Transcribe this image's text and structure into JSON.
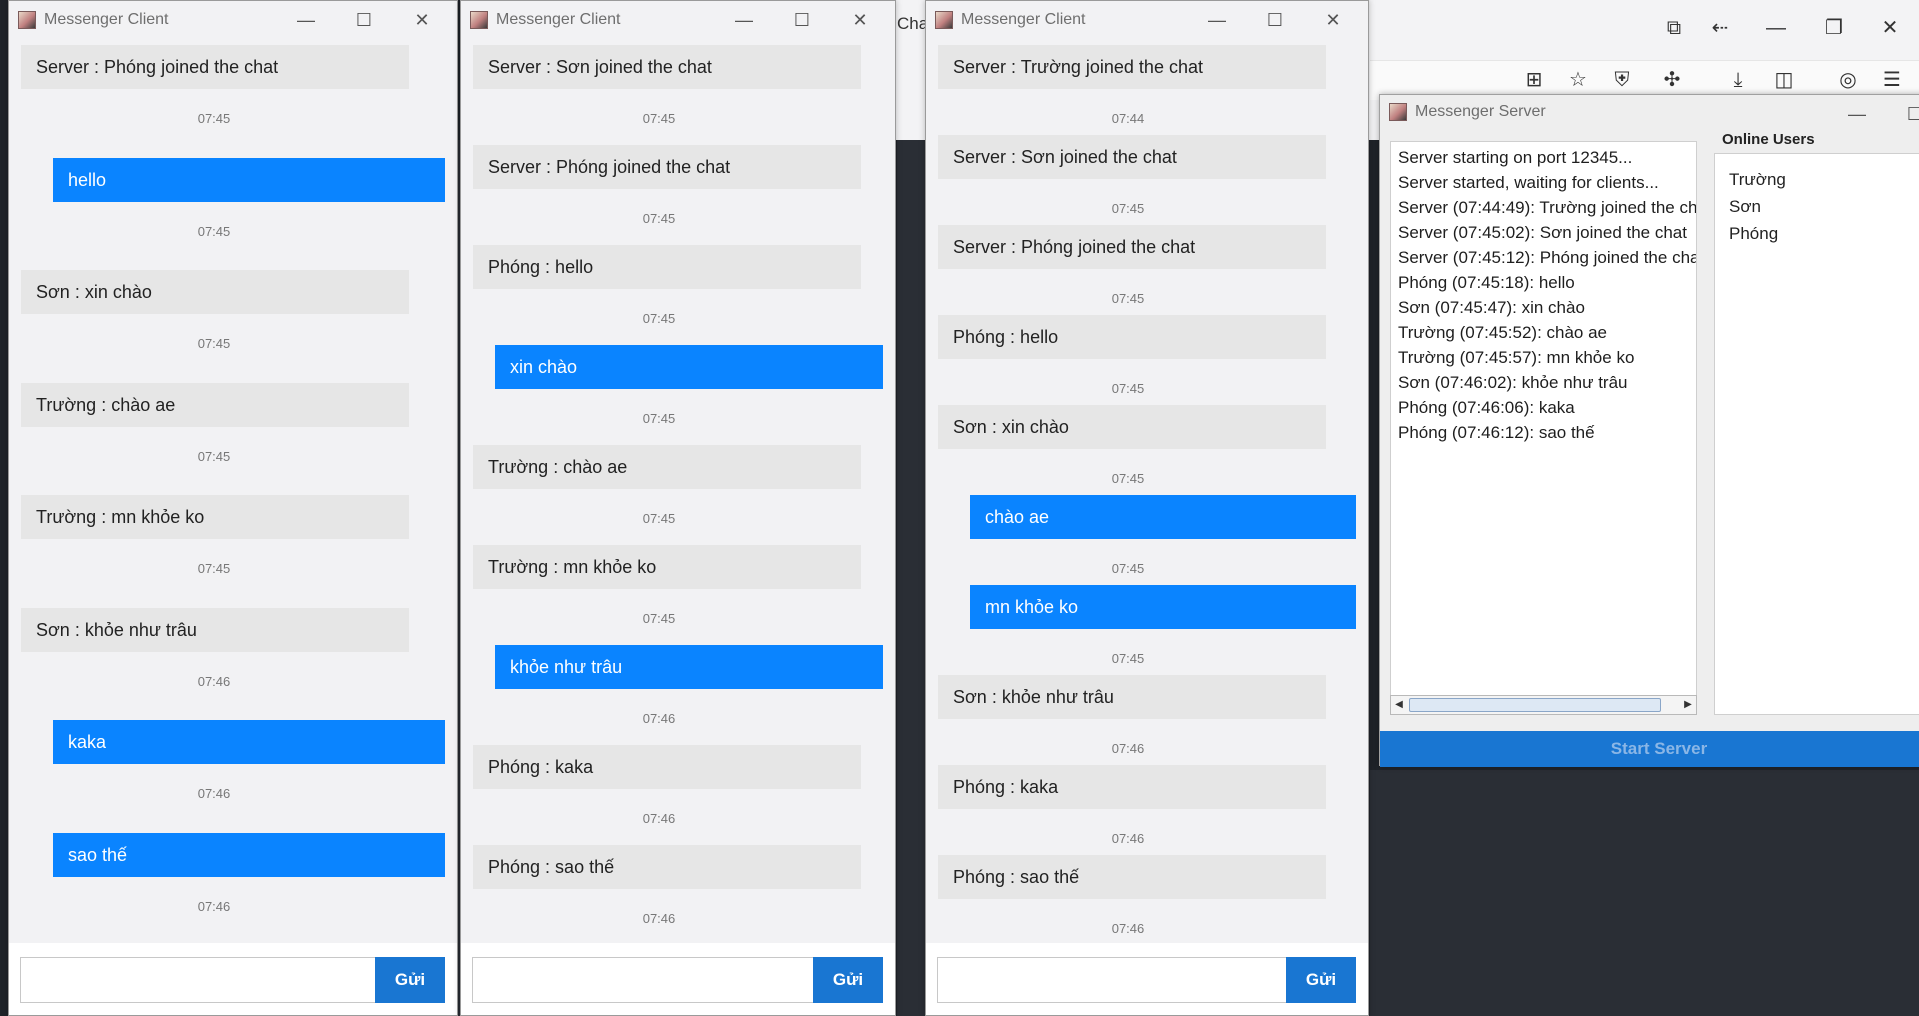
{
  "background": {
    "browser_label": "Chat"
  },
  "clients": [
    {
      "title": "Messenger Client",
      "send_label": "Gửi",
      "input_value": "",
      "messages": [
        {
          "type": "received",
          "text": "Server : Phóng joined the chat",
          "time": "07:45"
        },
        {
          "type": "sent",
          "text": "hello",
          "time": "07:45"
        },
        {
          "type": "received",
          "text": "Sơn : xin chào",
          "time": "07:45"
        },
        {
          "type": "received",
          "text": "Trường : chào ae",
          "time": "07:45"
        },
        {
          "type": "received",
          "text": "Trường : mn khỏe ko",
          "time": "07:45"
        },
        {
          "type": "received",
          "text": "Sơn : khỏe như trâu",
          "time": "07:46"
        },
        {
          "type": "sent",
          "text": "kaka",
          "time": "07:46"
        },
        {
          "type": "sent",
          "text": "sao thế",
          "time": "07:46"
        }
      ]
    },
    {
      "title": "Messenger Client",
      "send_label": "Gửi",
      "input_value": "",
      "messages": [
        {
          "type": "received",
          "text": "Server : Sơn joined the chat",
          "time": "07:45"
        },
        {
          "type": "received",
          "text": "Server : Phóng joined the chat",
          "time": "07:45"
        },
        {
          "type": "received",
          "text": "Phóng : hello",
          "time": "07:45"
        },
        {
          "type": "sent",
          "text": "xin chào",
          "time": "07:45"
        },
        {
          "type": "received",
          "text": "Trường : chào ae",
          "time": "07:45"
        },
        {
          "type": "received",
          "text": "Trường : mn khỏe ko",
          "time": "07:45"
        },
        {
          "type": "sent",
          "text": "khỏe như trâu",
          "time": "07:46"
        },
        {
          "type": "received",
          "text": "Phóng : kaka",
          "time": "07:46"
        },
        {
          "type": "received",
          "text": "Phóng : sao thế",
          "time": "07:46"
        }
      ]
    },
    {
      "title": "Messenger Client",
      "send_label": "Gửi",
      "input_value": "",
      "messages": [
        {
          "type": "received",
          "text": "Server : Trường joined the chat",
          "time": "07:44"
        },
        {
          "type": "received",
          "text": "Server : Sơn joined the chat",
          "time": "07:45"
        },
        {
          "type": "received",
          "text": "Server : Phóng joined the chat",
          "time": "07:45"
        },
        {
          "type": "received",
          "text": "Phóng : hello",
          "time": "07:45"
        },
        {
          "type": "received",
          "text": "Sơn : xin chào",
          "time": "07:45"
        },
        {
          "type": "sent",
          "text": "chào ae",
          "time": "07:45"
        },
        {
          "type": "sent",
          "text": "mn khỏe ko",
          "time": "07:45"
        },
        {
          "type": "received",
          "text": "Sơn : khỏe như trâu",
          "time": "07:46"
        },
        {
          "type": "received",
          "text": "Phóng : kaka",
          "time": "07:46"
        },
        {
          "type": "received",
          "text": "Phóng : sao thế",
          "time": "07:46"
        }
      ]
    }
  ],
  "server": {
    "title": "Messenger Server",
    "log": [
      "Server starting on port 12345...",
      "Server started, waiting for clients...",
      "Server (07:44:49): Trường joined the ch",
      "Server (07:45:02): Sơn joined the chat",
      "Server (07:45:12): Phóng joined the cha",
      "Phóng (07:45:18): hello",
      "Sơn (07:45:47): xin chào",
      "Trường (07:45:52): chào ae",
      "Trường (07:45:57): mn khỏe ko",
      "Sơn (07:46:02): khỏe như trâu",
      "Phóng (07:46:06): kaka",
      "Phóng (07:46:12): sao thế"
    ],
    "online_users_title": "Online Users",
    "online_users": [
      "Trường",
      "Sơn",
      "Phóng"
    ],
    "start_button": "Start Server"
  },
  "colors": {
    "sent_bubble": "#0a84ff",
    "received_bubble": "#e6e6e6",
    "send_button": "#1976d2"
  }
}
